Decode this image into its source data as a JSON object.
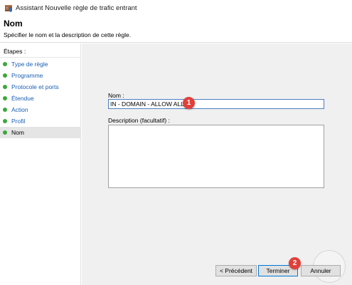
{
  "window": {
    "title": "Assistant Nouvelle règle de trafic entrant",
    "icon": "firewall-shield-icon"
  },
  "header": {
    "title": "Nom",
    "description": "Spécifier le nom et la description de cette règle."
  },
  "sidebar": {
    "heading": "Étapes :",
    "items": [
      {
        "label": "Type de règle",
        "status_color": "#3aa83a"
      },
      {
        "label": "Programme",
        "status_color": "#3aa83a"
      },
      {
        "label": "Protocole et ports",
        "status_color": "#3aa83a"
      },
      {
        "label": "Étendue",
        "status_color": "#3aa83a"
      },
      {
        "label": "Action",
        "status_color": "#3aa83a"
      },
      {
        "label": "Profil",
        "status_color": "#3aa83a"
      },
      {
        "label": "Nom",
        "status_color": "#3aa83a",
        "current": true
      }
    ]
  },
  "form": {
    "name_label": "Nom :",
    "name_value": "IN - DOMAIN - ALLOW ALL",
    "description_label": "Description (facultatif) :",
    "description_value": ""
  },
  "annotations": [
    {
      "number": "1",
      "color": "#e0403a"
    },
    {
      "number": "2",
      "color": "#e0403a"
    }
  ],
  "buttons": {
    "previous": "< Précédent",
    "finish": "Terminer",
    "cancel": "Annuler"
  }
}
